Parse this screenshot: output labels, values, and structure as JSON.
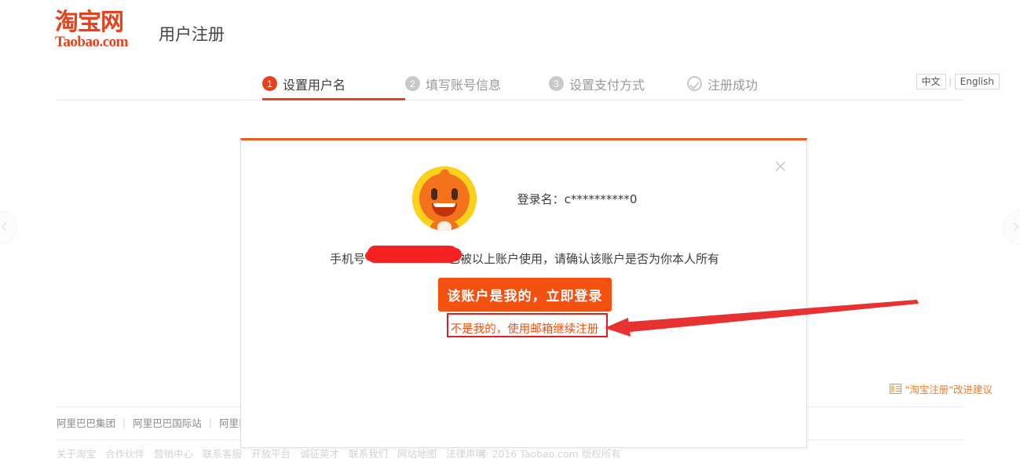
{
  "header": {
    "logo_cn": "淘宝网",
    "logo_en": "Taobao.com",
    "page_title": "用户注册"
  },
  "steps": [
    {
      "badge": "1",
      "label": "设置用户名",
      "state": "active"
    },
    {
      "badge": "2",
      "label": "填写账号信息",
      "state": "inactive"
    },
    {
      "badge": "3",
      "label": "设置支付方式",
      "state": "inactive"
    },
    {
      "badge": "check-icon",
      "label": "注册成功",
      "state": "inactive"
    }
  ],
  "language": {
    "chinese": "中文",
    "separator": "|",
    "english": "English"
  },
  "modal": {
    "close_label": "×",
    "avatar_icon": "taobao-mascot-avatar",
    "login_name_label": "登录名：",
    "login_name_value": "c**********0",
    "notice_prefix": "手机号",
    "notice_masked": "",
    "notice_suffix": "已被以上账户使用，请确认该账户是否为你本人所有",
    "primary_button": "该账户是我的，立即登录",
    "secondary_link": "不是我的，使用邮箱继续注册"
  },
  "feedback": {
    "icon": "note-icon",
    "text": "\"淘宝注册\"改进建议"
  },
  "footer": {
    "partner_links": [
      "阿里巴巴集团",
      "阿里巴巴国际站",
      "阿里巴"
    ],
    "site_links": [
      "关于淘宝",
      "合作伙伴",
      "营销中心",
      "联系客服",
      "开放平台",
      "诚征英才",
      "联系我们",
      "网站地图",
      "法律声明"
    ],
    "copyright": "© 2016 Taobao.com 版权所有"
  },
  "annotations": {
    "redaction_color": "#f42222",
    "highlight_color": "#e02020",
    "arrow_color": "#e83131"
  },
  "colors": {
    "brand_orange": "#e4431d",
    "primary_button": "#f4500f",
    "modal_top_border": "#f05922",
    "inactive_gray": "#9a9a9a"
  }
}
